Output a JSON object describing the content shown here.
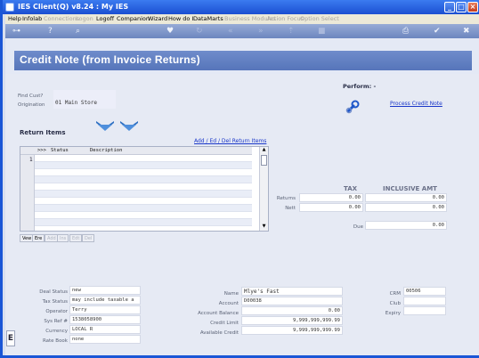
{
  "window": {
    "title": "IES Client(Q) v8.24 : My IES"
  },
  "menu": [
    {
      "label": "Help",
      "enabled": true
    },
    {
      "label": "Infolab",
      "enabled": true
    },
    {
      "label": "Connections",
      "enabled": false
    },
    {
      "label": "Logon",
      "enabled": false
    },
    {
      "label": "Logoff",
      "enabled": true
    },
    {
      "label": "Companion",
      "enabled": true
    },
    {
      "label": "Wizard",
      "enabled": true
    },
    {
      "label": "How do I",
      "enabled": true
    },
    {
      "label": "DataMarts",
      "enabled": true
    },
    {
      "label": "Business Modules",
      "enabled": false
    },
    {
      "label": "Action Focus",
      "enabled": false
    },
    {
      "label": "Option Select",
      "enabled": false
    }
  ],
  "page": {
    "title": "Credit Note (from Invoice Returns)"
  },
  "find": {
    "cust_label": "Find Cust?",
    "orig_label": "Origination",
    "orig_value": "01 Main Store"
  },
  "perform": {
    "label": "Perform: -",
    "action_link": "Process Credit Note"
  },
  "returns": {
    "section_title": "Return Items",
    "add_link": "Add / Ed / Del Return Items",
    "columns": {
      "marker": ">>>",
      "status": "Status",
      "description": "Description"
    },
    "first_row_num": "1",
    "buttons": [
      {
        "label": "Vew",
        "enabled": true
      },
      {
        "label": "Ere",
        "enabled": true
      },
      {
        "label": "Add",
        "enabled": false
      },
      {
        "label": "Ins",
        "enabled": false
      },
      {
        "label": "Edt",
        "enabled": false
      },
      {
        "label": "Del",
        "enabled": false
      }
    ]
  },
  "totals": {
    "col_tax": "TAX",
    "col_incl": "INCLUSIVE AMT",
    "returns_label": "Returns",
    "returns_tax": "0.00",
    "returns_incl": "0.00",
    "nett_label": "Nett",
    "nett_tax": "0.00",
    "nett_incl": "0.00",
    "due_label": "Due",
    "due_value": "0.00"
  },
  "deal": {
    "status_label": "Deal Status",
    "status_value": "new",
    "tax_label": "Tax Status",
    "tax_value": "may include taxable a",
    "operator_label": "Operator",
    "operator_value": "Terry",
    "sysref_label": "Sys Ref #",
    "sysref_value": "1538058900",
    "currency_label": "Currency",
    "currency_value": "LOCAL R",
    "rate_label": "Rate Book",
    "rate_value": "none"
  },
  "account": {
    "name_label": "Name",
    "name_value": "Mlye's Fast",
    "account_label": "Account",
    "account_value": "D00038",
    "balance_label": "Account Balance",
    "balance_value": "0.00",
    "limit_label": "Credit Limit",
    "limit_value": "9,999,999,999.99",
    "avail_label": "Available Credit",
    "avail_value": "9,999,999,999.99"
  },
  "crm": {
    "crm_label": "CRM",
    "crm_value": "00506",
    "club_label": "Club",
    "club_value": "",
    "expiry_label": "Expiry",
    "expiry_value": ""
  },
  "colors": {
    "accent": "#5675ba",
    "titlebar": "#1b4fd1",
    "link": "#1a37c9"
  }
}
